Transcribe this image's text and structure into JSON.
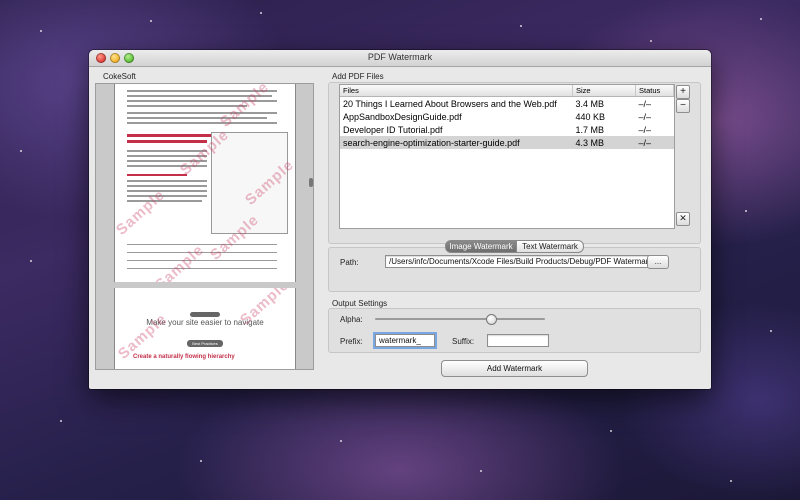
{
  "window": {
    "title": "PDF Watermark"
  },
  "preview": {
    "label": "CokeSoft",
    "watermark_text": "Sample",
    "page2_heading": "Make your site easier to navigate",
    "page2_button": "Best Practices",
    "page2_subheading": "Create a naturally flowing hierarchy"
  },
  "files": {
    "label": "Add PDF Files",
    "columns": [
      "Files",
      "Size",
      "Status"
    ],
    "rows": [
      {
        "name": "20 Things I Learned About Browsers and the Web.pdf",
        "size": "3.4 MB",
        "status": "–/–"
      },
      {
        "name": "AppSandboxDesignGuide.pdf",
        "size": "440 KB",
        "status": "–/–"
      },
      {
        "name": "Developer ID Tutorial.pdf",
        "size": "1.7 MB",
        "status": "–/–"
      },
      {
        "name": "search-engine-optimization-starter-guide.pdf",
        "size": "4.3 MB",
        "status": "–/–"
      }
    ],
    "selected_row": 3,
    "add_label": "+",
    "remove_label": "−",
    "clear_label": "✕"
  },
  "watermark_tabs": {
    "tabs": [
      "Image Watermark",
      "Text Watermark"
    ],
    "active": "Image Watermark",
    "path_label": "Path:",
    "path_value": "/Users/infc/Documents/Xcode Files/Build Products/Debug/PDF Watermark",
    "browse_label": "..."
  },
  "output": {
    "label": "Output Settings",
    "alpha_label": "Alpha:",
    "alpha_value": 0.68,
    "prefix_label": "Prefix:",
    "prefix_value": "watermark_",
    "suffix_label": "Suffix:",
    "suffix_value": ""
  },
  "action": {
    "add_label": "Add Watermark"
  },
  "colors": {
    "selection": "#d4d4d4",
    "focus_ring": "#7aa6e4",
    "watermark": "#c83c64"
  }
}
